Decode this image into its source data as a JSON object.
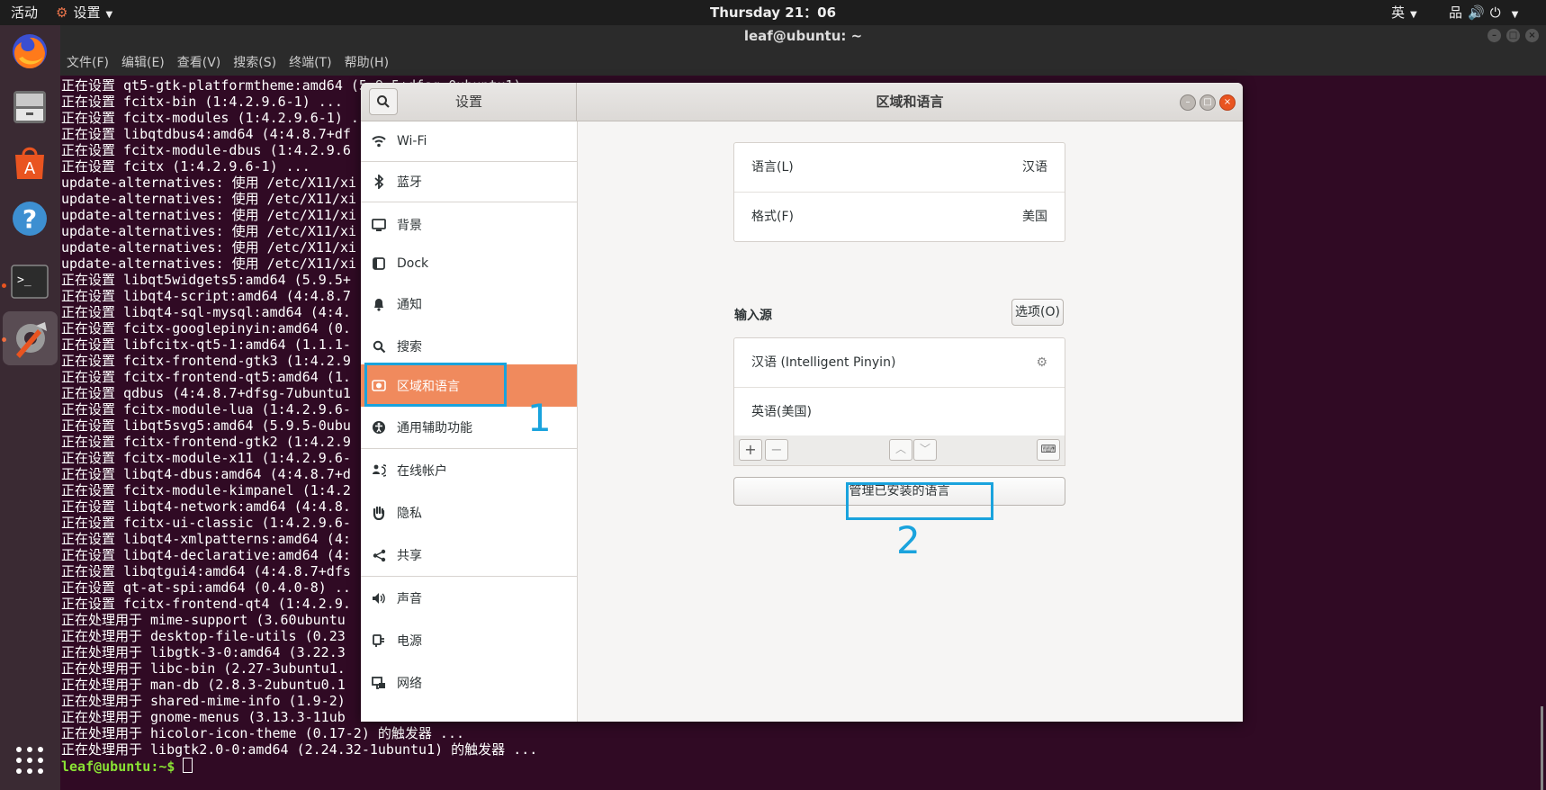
{
  "topbar": {
    "activities": "活动",
    "app_menu": "设置",
    "clock": "Thursday 21：06",
    "input_method": "英"
  },
  "terminal": {
    "title": "leaf@ubuntu: ~",
    "menu": [
      "文件(F)",
      "编辑(E)",
      "查看(V)",
      "搜索(S)",
      "终端(T)",
      "帮助(H)"
    ],
    "lines": [
      "正在设置 qt5-gtk-platformtheme:amd64 (5.9.5+dfsg-0ubuntu1) ...",
      "正在设置 fcitx-bin (1:4.2.9.6-1) ...",
      "正在设置 fcitx-modules (1:4.2.9.6-1) ...",
      "正在设置 libqtdbus4:amd64 (4:4.8.7+df",
      "正在设置 fcitx-module-dbus (1:4.2.9.6",
      "正在设置 fcitx (1:4.2.9.6-1) ...",
      "update-alternatives: 使用 /etc/X11/xi",
      "update-alternatives: 使用 /etc/X11/xi",
      "update-alternatives: 使用 /etc/X11/xi",
      "update-alternatives: 使用 /etc/X11/xi",
      "update-alternatives: 使用 /etc/X11/xi",
      "update-alternatives: 使用 /etc/X11/xi",
      "正在设置 libqt5widgets5:amd64 (5.9.5+",
      "正在设置 libqt4-script:amd64 (4:4.8.7",
      "正在设置 libqt4-sql-mysql:amd64 (4:4.",
      "正在设置 fcitx-googlepinyin:amd64 (0.",
      "正在设置 libfcitx-qt5-1:amd64 (1.1.1-",
      "正在设置 fcitx-frontend-gtk3 (1:4.2.9",
      "正在设置 fcitx-frontend-qt5:amd64 (1.",
      "正在设置 qdbus (4:4.8.7+dfsg-7ubuntu1",
      "正在设置 fcitx-module-lua (1:4.2.9.6-",
      "正在设置 libqt5svg5:amd64 (5.9.5-0ubu",
      "正在设置 fcitx-frontend-gtk2 (1:4.2.9",
      "正在设置 fcitx-module-x11 (1:4.2.9.6-",
      "正在设置 libqt4-dbus:amd64 (4:4.8.7+d",
      "正在设置 fcitx-module-kimpanel (1:4.2",
      "正在设置 libqt4-network:amd64 (4:4.8.",
      "正在设置 fcitx-ui-classic (1:4.2.9.6-",
      "正在设置 libqt4-xmlpatterns:amd64 (4:",
      "正在设置 libqt4-declarative:amd64 (4:",
      "正在设置 libqtgui4:amd64 (4:4.8.7+dfs",
      "正在设置 qt-at-spi:amd64 (0.4.0-8) ..",
      "正在设置 fcitx-frontend-qt4 (1:4.2.9.",
      "正在处理用于 mime-support (3.60ubuntu",
      "正在处理用于 desktop-file-utils (0.23",
      "正在处理用于 libgtk-3-0:amd64 (3.22.3",
      "正在处理用于 libc-bin (2.27-3ubuntu1.",
      "正在处理用于 man-db (2.8.3-2ubuntu0.1",
      "正在处理用于 shared-mime-info (1.9-2)",
      "正在处理用于 gnome-menus (3.13.3-11ub",
      "正在处理用于 hicolor-icon-theme (0.17-2) 的触发器 ...",
      "正在处理用于 libgtk2.0-0:amd64 (2.24.32-1ubuntu1) 的触发器 ..."
    ],
    "prompt": "leaf@ubuntu:~$ "
  },
  "settings": {
    "left_title": "设置",
    "right_title": "区域和语言",
    "nav": [
      {
        "label": "Wi-Fi",
        "icon": "wifi-icon"
      },
      {
        "label": "蓝牙",
        "icon": "bluetooth-icon"
      },
      {
        "label": "背景",
        "icon": "background-icon"
      },
      {
        "label": "Dock",
        "icon": "dock-icon"
      },
      {
        "label": "通知",
        "icon": "bell-icon"
      },
      {
        "label": "搜索",
        "icon": "search-icon"
      },
      {
        "label": "区域和语言",
        "icon": "region-language-icon"
      },
      {
        "label": "通用辅助功能",
        "icon": "accessibility-icon"
      },
      {
        "label": "在线帐户",
        "icon": "online-accounts-icon"
      },
      {
        "label": "隐私",
        "icon": "privacy-hand-icon"
      },
      {
        "label": "共享",
        "icon": "share-icon"
      },
      {
        "label": "声音",
        "icon": "speaker-icon"
      },
      {
        "label": "电源",
        "icon": "power-plug-icon"
      },
      {
        "label": "网络",
        "icon": "network-icon"
      }
    ],
    "selected": "区域和语言",
    "language_label": "语言(L)",
    "language_value": "汉语",
    "format_label": "格式(F)",
    "format_value": "美国",
    "input_sources_title": "输入源",
    "options_button": "选项(O)",
    "input_sources": [
      "汉语 (Intelligent Pinyin)",
      "英语(美国)"
    ],
    "manage_button": "管理已安装的语言"
  },
  "annotations": [
    "1",
    "2"
  ],
  "colors": {
    "selection": "#f08a5d",
    "annotation": "#1aa3dd",
    "terminal_bg": "#300a24",
    "prompt": "#8ae234"
  }
}
